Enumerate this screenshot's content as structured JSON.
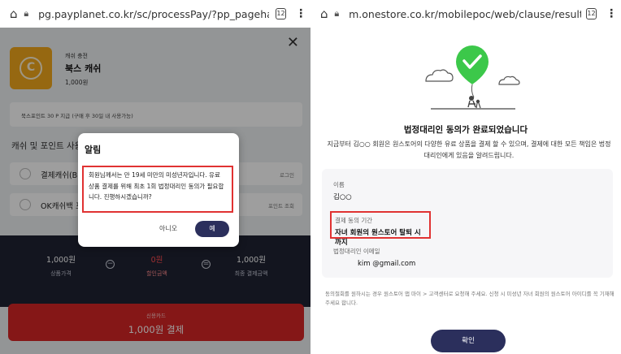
{
  "left": {
    "browser": {
      "url": "pg.payplanet.co.kr/sc/processPay/?pp_pagehash=",
      "tab_count": "12"
    },
    "product": {
      "category": "캐쉬 충전",
      "name": "북스 캐쉬",
      "price": "1,000원"
    },
    "point_notice": "북스포인트 30 P 지급 (구매 후 30일 내 사용가능)",
    "section_title": "캐쉬 및 포인트 사용",
    "pay_rows": [
      {
        "label": "결제캐쉬(B",
        "right": "로그인"
      },
      {
        "label": "OK캐쉬백 포",
        "right": "포인트 조회"
      }
    ],
    "summary": {
      "product_amount": "1,000원",
      "product_label": "상품가격",
      "discount_amount": "0원",
      "discount_label": "할인금액",
      "final_amount": "1,000원",
      "final_label": "최종 결제금액"
    },
    "pay_button": {
      "sub": "신용카드",
      "label": "1,000원 결제"
    },
    "dialog": {
      "title": "알림",
      "message": "회원님께서는 만 19세 미만의 미성년자입니다. 유료 상품 결제를 위해 최초 1회 법정대리인 동의가 필요합니다. 진행하시겠습니까?",
      "no_label": "아니오",
      "yes_label": "예"
    }
  },
  "right": {
    "browser": {
      "url": "m.onestore.co.kr/mobilepoc/web/clause/resultReg",
      "tab_count": "12"
    },
    "title": "법정대리인 동의가 완료되었습니다",
    "description": "지금부터 김○○ 회원은 원스토어의 다양한 유료 상품을 결제 할 수 있으며, 결제에 대한 모든 책임은 법정대리인에게 있음을 알려드립니다.",
    "info": {
      "name_label": "이름",
      "name_value": "김○○",
      "period_label": "결제 동의 기간",
      "period_value": "자녀 회원의 원스토어 탈퇴 시 까지",
      "email_label": "법정대리인 이메일",
      "email_value": "kim @gmail.com"
    },
    "note": "동의철회를 원하시는 경우 원스토어 앱 마이 > 고객센터로 요청해 주세요. 신청 시 미성년 자녀 회원의 원스토어 아이디를 꼭 기재해 주세요 합니다.",
    "confirm_label": "확인"
  },
  "colors": {
    "accent_navy": "#2b2f5c",
    "highlight_red": "#e03232",
    "pay_red": "#d72626",
    "success_green": "#3cc84a",
    "coin_orange": "#f2a91c"
  },
  "icons": [
    "home-icon",
    "lock-icon",
    "tabs-icon",
    "more-icon",
    "close-icon",
    "coin-icon",
    "check-icon",
    "cloud-icon"
  ]
}
